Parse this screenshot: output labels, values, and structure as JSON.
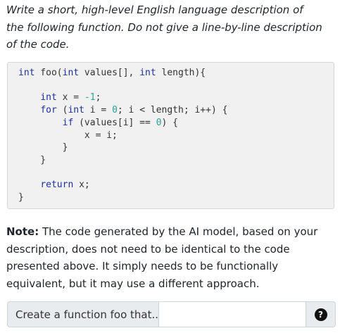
{
  "prompt": {
    "text": "Write a short, high-level English language description of the following function. Do not give a line-by-line description of the code."
  },
  "code": {
    "line1_kw1": "int",
    "line1_rest1": " foo(",
    "line1_kw2": "int",
    "line1_rest2": " values[], ",
    "line1_kw3": "int",
    "line1_rest3": " length){",
    "line2": "",
    "line3_indent": "    ",
    "line3_kw": "int",
    "line3_rest": " x = ",
    "line3_num": "-1",
    "line3_end": ";",
    "line4_indent": "    ",
    "line4_kw": "for",
    "line4_a": " (",
    "line4_kw2": "int",
    "line4_b": " i = ",
    "line4_num": "0",
    "line4_c": "; i < length; i++) {",
    "line5_indent": "        ",
    "line5_kw": "if",
    "line5_a": " (values[i] == ",
    "line5_num": "0",
    "line5_b": ") {",
    "line6": "            x = i;",
    "line7": "        }",
    "line8": "    }",
    "line9": "",
    "line10_indent": "    ",
    "line10_kw": "return",
    "line10_rest": " x;",
    "line11": "}"
  },
  "note": {
    "label": "Note:",
    "text": " The code generated by the AI model, based on your description, does not need to be identical to the code presented above. It simply needs to be functionally equivalent, but it may use a different approach."
  },
  "input": {
    "prefix": "Create a function foo that...",
    "value": "",
    "placeholder": ""
  },
  "help": {
    "icon": "question-circle-icon",
    "glyph": "?"
  }
}
